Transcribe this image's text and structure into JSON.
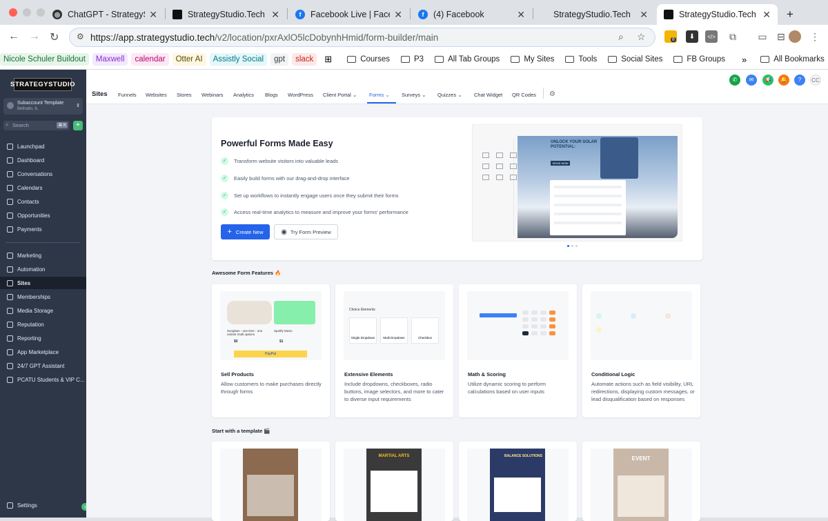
{
  "browser": {
    "tabs": [
      {
        "title": "ChatGPT - StrategyStudi",
        "icon": "openai-icon"
      },
      {
        "title": "StrategyStudio.Tech",
        "icon": "strategystudio-icon"
      },
      {
        "title": "Facebook Live | Facebook",
        "icon": "facebook-icon"
      },
      {
        "title": "(4) Facebook",
        "icon": "facebook-icon"
      },
      {
        "title": "StrategyStudio.Tech",
        "icon": "none"
      },
      {
        "title": "StrategyStudio.Tech",
        "icon": "strategystudio-icon"
      }
    ],
    "new_tab": "+",
    "url_host": "https://app.strategystudio.tech",
    "url_path": "/v2/location/pxrAxlO5lcDobynhHmid/form-builder/main",
    "extension_badge": "8",
    "bookmarks_chips": [
      {
        "label": "Nicole Schuler Buildout",
        "bg": "#e6f4ea",
        "fg": "#137333"
      },
      {
        "label": "Maxwell",
        "bg": "#f3e8fd",
        "fg": "#8430ce"
      },
      {
        "label": "calendar",
        "bg": "#fce8f3",
        "fg": "#b80672"
      },
      {
        "label": "Otter AI",
        "bg": "#fef7e0",
        "fg": "#594b07"
      },
      {
        "label": "Assistly Social",
        "bg": "#e4f7fb",
        "fg": "#007b83"
      },
      {
        "label": "gpt",
        "bg": "#f1f3f4",
        "fg": "#3c4043"
      },
      {
        "label": "slack",
        "bg": "#fce8e6",
        "fg": "#c5221f"
      }
    ],
    "bookmark_folders": [
      "Courses",
      "P3",
      "All Tab Groups",
      "My Sites",
      "Tools",
      "Social Sites",
      "FB Groups"
    ],
    "more": "»",
    "all_bookmarks": "All Bookmarks"
  },
  "sidebar": {
    "logo": "STRATEGYSTUDIO",
    "account_name": "Subaccount Template",
    "account_location": "Bethalto, IL",
    "search_placeholder": "Search",
    "search_shortcut": "⌘ K",
    "items_top": [
      {
        "label": "Launchpad",
        "icon": "rocket-icon"
      },
      {
        "label": "Dashboard",
        "icon": "dashboard-icon"
      },
      {
        "label": "Conversations",
        "icon": "chat-icon"
      },
      {
        "label": "Calendars",
        "icon": "calendar-icon"
      },
      {
        "label": "Contacts",
        "icon": "contacts-icon"
      },
      {
        "label": "Opportunities",
        "icon": "opportunities-icon"
      },
      {
        "label": "Payments",
        "icon": "payments-icon"
      }
    ],
    "items_bottom": [
      {
        "label": "Marketing",
        "icon": "marketing-icon"
      },
      {
        "label": "Automation",
        "icon": "automation-icon"
      },
      {
        "label": "Sites",
        "icon": "sites-icon",
        "active": true
      },
      {
        "label": "Memberships",
        "icon": "memberships-icon"
      },
      {
        "label": "Media Storage",
        "icon": "media-icon"
      },
      {
        "label": "Reputation",
        "icon": "star-icon"
      },
      {
        "label": "Reporting",
        "icon": "reporting-icon"
      },
      {
        "label": "App Marketplace",
        "icon": "marketplace-icon"
      },
      {
        "label": "24/7 GPT Assistant",
        "icon": "assistant-icon"
      },
      {
        "label": "PCATU Students & VIP C...",
        "icon": "group-icon"
      }
    ],
    "settings": "Settings"
  },
  "topnav": {
    "title": "Sites",
    "items": [
      "Funnels",
      "Websites",
      "Stores",
      "Webinars",
      "Analytics",
      "Blogs",
      "WordPress",
      "Client Portal",
      "Forms",
      "Surveys",
      "Quizzes",
      "Chat Widget",
      "QR Codes"
    ],
    "active": "Forms",
    "status_colors": [
      "#16a34a",
      "#3b82f6",
      "#22c55e",
      "#f97316",
      "#3b82f6",
      "#e5e7eb"
    ],
    "avatar_initials": "CC"
  },
  "hero": {
    "title": "Powerful Forms Made Easy",
    "bullets": [
      "Transform website visitors into valuable leads",
      "Easily build forms with our drag-and-drop interface",
      "Set up workflows to instantly engage users once they submit their forms",
      "Access real-time analytics to measure and improve your forms' performance"
    ],
    "create_new": "Create New",
    "try_preview": "Try Form Preview",
    "preview_heading": "UNLOCK YOUR SOLAR POTENTIAL:",
    "preview_button": "BOOK NOW"
  },
  "features": {
    "section_title": "Awesome Form Features 🔥",
    "cards": [
      {
        "title": "Sell Products",
        "desc": "Allow customers to make purchases directly through forms"
      },
      {
        "title": "Extensive Elements",
        "desc": "Include dropdowns, checkboxes, radio buttons, image selectors, and more to cater to diverse input requirements"
      },
      {
        "title": "Math & Scoring",
        "desc": "Utilize dynamic scoring to perform calculations based on user inputs"
      },
      {
        "title": "Conditional Logic",
        "desc": "Automate actions such as field visibility, URL redirections, displaying custom messages, or lead disqualification based on responses"
      }
    ],
    "choice_elements_title": "Choice Elements",
    "choice_elements": [
      "Single Dropdown",
      "Multi Dropdown",
      "Checkbox"
    ],
    "product_labels": [
      "Sunglass - one time - one variant multi options",
      "Spotify Music"
    ],
    "product_prices": [
      "$0",
      "$1"
    ],
    "paypal": "PayPal"
  },
  "templates": {
    "section_title": "Start with a template 🎬",
    "posters": [
      {
        "text": "",
        "bg": "#8b6a4f"
      },
      {
        "text": "MARTIAL ARTS",
        "bg": "#3a3a3a"
      },
      {
        "text": "BALANCE SOLUTIONS",
        "bg": "#2b3a67"
      },
      {
        "text": "EVENT",
        "bg": "#c9b8a8"
      }
    ]
  }
}
